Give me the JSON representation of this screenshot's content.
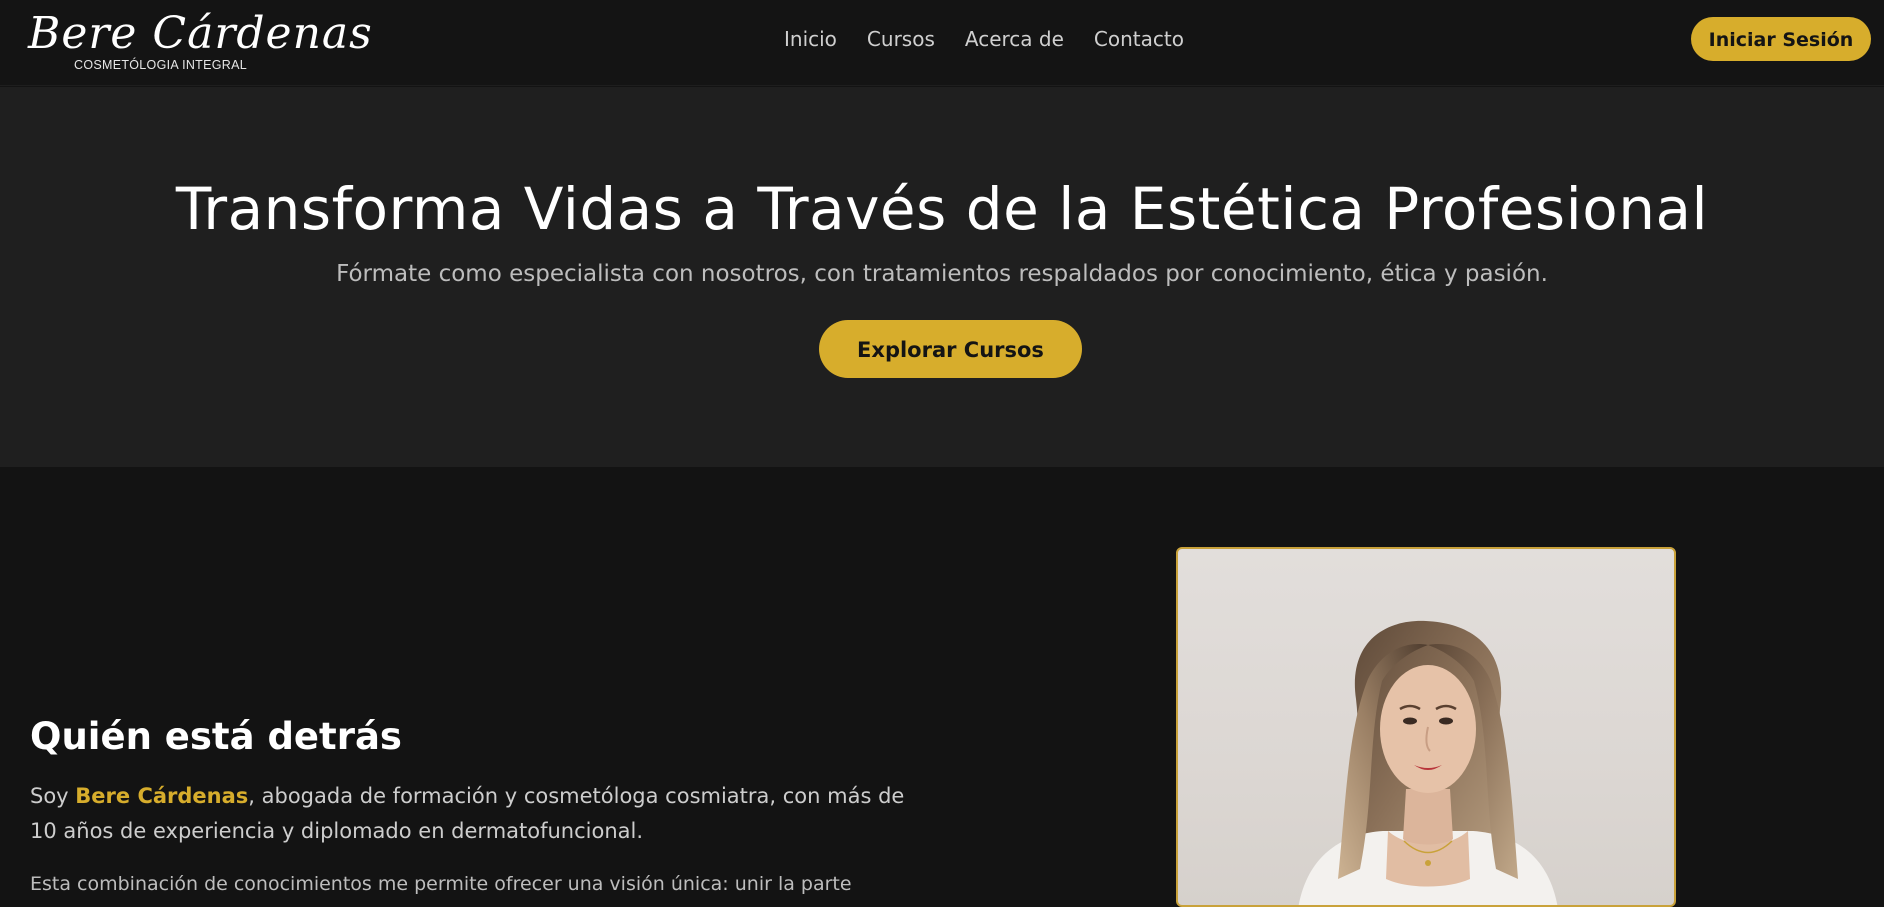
{
  "header": {
    "logo_script": "Bere Cárdenas",
    "logo_subtitle": "COSMETÓLOGIA INTEGRAL",
    "nav": [
      {
        "label": "Inicio"
      },
      {
        "label": "Cursos"
      },
      {
        "label": "Acerca de"
      },
      {
        "label": "Contacto"
      }
    ],
    "login_label": "Iniciar Sesión"
  },
  "hero": {
    "title": "Transforma Vidas a Través de la Estética Profesional",
    "subtitle": "Fórmate como especialista con nosotros, con tratamientos respaldados por conocimiento, ética y pasión.",
    "cta_label": "Explorar Cursos"
  },
  "about": {
    "title": "Quién está detrás",
    "intro_prefix": "Soy ",
    "intro_name": "Bere Cárdenas",
    "intro_rest": ", abogada de formación y cosmetóloga cosmiatra, con más de 10 años de experiencia y diplomado en dermatofuncional.",
    "paragraph2": "Esta combinación de conocimientos me permite ofrecer una visión única: unir la parte"
  },
  "colors": {
    "accent": "#d7ad2c",
    "header_bg": "#141414",
    "hero_bg": "#1f1f1f",
    "section_bg": "#131313",
    "photo_border": "#c9a23a"
  },
  "photo": {
    "icon": "portrait-photo"
  }
}
